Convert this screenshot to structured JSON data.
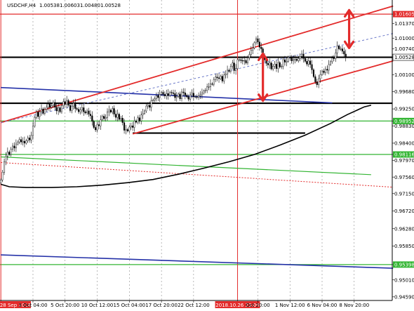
{
  "chart_data": {
    "type": "candlestick",
    "title": "USDCHF,H4",
    "header_values": [
      "1.00538",
      "1.00603",
      "1.00480",
      "1.00528"
    ],
    "ylim": [
      0.945,
      1.0195
    ],
    "y_ticks": [
      {
        "value": 1.016,
        "label": "1.01605",
        "highlight": "#e32b2b"
      },
      {
        "value": 1.0137,
        "label": "1.01370"
      },
      {
        "value": 1.01,
        "label": "1.01000"
      },
      {
        "value": 1.0074,
        "label": "1.00740"
      },
      {
        "value": 1.0053,
        "label": "1.00528",
        "highlight": "#ffffff"
      },
      {
        "value": 1.001,
        "label": "1.00100"
      },
      {
        "value": 0.9968,
        "label": "0.99680"
      },
      {
        "value": 0.9925,
        "label": "0.99250"
      },
      {
        "value": 0.9895,
        "label": "0.98952",
        "highlight": "#33b533"
      },
      {
        "value": 0.9883,
        "label": "0.98830"
      },
      {
        "value": 0.984,
        "label": "0.98400"
      },
      {
        "value": 0.9812,
        "label": "0.98116",
        "highlight": "#33b533"
      },
      {
        "value": 0.9797,
        "label": "0.97970"
      },
      {
        "value": 0.9756,
        "label": "0.97560"
      },
      {
        "value": 0.9715,
        "label": "0.97150"
      },
      {
        "value": 0.9672,
        "label": "0.96720"
      },
      {
        "value": 0.9628,
        "label": "0.96280"
      },
      {
        "value": 0.9585,
        "label": "0.95850"
      },
      {
        "value": 0.9539,
        "label": "0.95398",
        "highlight": "#33b533"
      },
      {
        "value": 0.9501,
        "label": "0.95010"
      },
      {
        "value": 0.9459,
        "label": "0.94590"
      }
    ],
    "x_labels": [
      {
        "idx": 0,
        "label": "28 Sep 2018",
        "highlight": "#e32b2b"
      },
      {
        "idx": 19,
        "label": "3 Oct 04:00"
      },
      {
        "idx": 38,
        "label": "5 Oct 20:00"
      },
      {
        "idx": 57,
        "label": "10 Oct 12:00"
      },
      {
        "idx": 76,
        "label": "15 Oct 04:00"
      },
      {
        "idx": 95,
        "label": "17 Oct 20:00"
      },
      {
        "idx": 114,
        "label": "22 Oct 12:00"
      },
      {
        "idx": 140,
        "label": "2018.10.26 23:00",
        "highlight": "#e32b2b"
      },
      {
        "idx": 152,
        "label": "Oct 20:00"
      },
      {
        "idx": 171,
        "label": "1 Nov 12:00"
      },
      {
        "idx": 190,
        "label": "6 Nov 04:00"
      },
      {
        "idx": 209,
        "label": "8 Nov 20:00"
      }
    ],
    "series_close": [
      0.9749,
      0.9768,
      0.9794,
      0.9808,
      0.9818,
      0.9812,
      0.9825,
      0.9833,
      0.9828,
      0.9838,
      0.9843,
      0.9849,
      0.9843,
      0.9845,
      0.984,
      0.9846,
      0.9853,
      0.9848,
      0.9859,
      0.9882,
      0.9904,
      0.9917,
      0.9906,
      0.9918,
      0.9925,
      0.9914,
      0.9924,
      0.9929,
      0.9937,
      0.9929,
      0.9933,
      0.9941,
      0.9929,
      0.992,
      0.9928,
      0.9918,
      0.9933,
      0.9943,
      0.9936,
      0.9946,
      0.9934,
      0.9921,
      0.9932,
      0.9939,
      0.9926,
      0.9924,
      0.9918,
      0.9922,
      0.9928,
      0.9918,
      0.9915,
      0.992,
      0.9912,
      0.9908,
      0.9894,
      0.9879,
      0.9873,
      0.9886,
      0.9883,
      0.9898,
      0.9907,
      0.9901,
      0.9904,
      0.9917,
      0.9922,
      0.9917,
      0.9926,
      0.9912,
      0.9904,
      0.9912,
      0.9899,
      0.9902,
      0.9891,
      0.9872,
      0.9874,
      0.987,
      0.988,
      0.9883,
      0.9879,
      0.9895,
      0.9892,
      0.9903,
      0.9895,
      0.991,
      0.9914,
      0.992,
      0.9932,
      0.9934,
      0.9929,
      0.9945,
      0.9947,
      0.995,
      0.9958,
      0.9953,
      0.9961,
      0.9966,
      0.9961,
      0.9957,
      0.9963,
      0.9958,
      0.9966,
      0.9965,
      0.9963,
      0.9953,
      0.9956,
      0.9962,
      0.995,
      0.9967,
      0.9965,
      0.9959,
      0.9955,
      0.9949,
      0.996,
      0.9964,
      0.9955,
      0.9955,
      0.9954,
      0.9958,
      0.996,
      0.9964,
      0.9969,
      0.9971,
      0.998,
      0.998,
      0.9987,
      0.9986,
      0.9998,
      1.0004,
      1.0002,
      1.0,
      1.0006,
      0.9994,
      1.0009,
      1.0011,
      1.0021,
      1.0018,
      1.0031,
      1.0039,
      1.002,
      1.0025,
      1.0047,
      1.0047,
      1.0045,
      1.0044,
      1.0045,
      1.0039,
      1.0052,
      1.006,
      1.0071,
      1.0076,
      1.0089,
      1.0099,
      1.0091,
      1.0078,
      1.0074,
      1.0057,
      1.0047,
      1.0038,
      1.0034,
      1.0039,
      1.0024,
      1.0031,
      1.0036,
      1.0025,
      1.004,
      1.0029,
      1.003,
      1.0047,
      1.0041,
      1.0043,
      1.0053,
      1.0051,
      1.0044,
      1.0048,
      1.0048,
      1.0045,
      1.005,
      1.0055,
      1.0061,
      1.005,
      1.0043,
      1.0036,
      1.0044,
      1.0035,
      1.0022,
      1.0005,
      0.9992,
      0.9985,
      1.0,
      1.001,
      1.0019,
      1.0015,
      1.0023,
      1.0021,
      1.0035,
      1.0042,
      1.0051,
      1.005,
      1.0064,
      1.0081,
      1.0074,
      1.0074,
      1.0068,
      1.0061,
      1.0053
    ],
    "ma_long": [
      [
        0,
        0.9738
      ],
      [
        5,
        0.9732
      ],
      [
        15,
        0.973
      ],
      [
        30,
        0.973
      ],
      [
        45,
        0.9732
      ],
      [
        60,
        0.9736
      ],
      [
        75,
        0.9742
      ],
      [
        90,
        0.975
      ],
      [
        105,
        0.9763
      ],
      [
        120,
        0.9778
      ],
      [
        135,
        0.9794
      ],
      [
        150,
        0.9812
      ],
      [
        165,
        0.9835
      ],
      [
        180,
        0.986
      ],
      [
        195,
        0.9889
      ],
      [
        205,
        0.9911
      ],
      [
        215,
        0.993
      ],
      [
        219,
        0.9934
      ]
    ],
    "ma_long_2": [
      [
        0,
        0.9806
      ],
      [
        219,
        0.9762
      ]
    ],
    "ma_dashed": [
      [
        0,
        0.9792
      ],
      [
        232,
        0.9731
      ]
    ],
    "horizontal_levels": [
      {
        "value": 1.016,
        "color": "#e32b2b",
        "width": 1.2
      },
      {
        "value": 1.0053,
        "color": "#000000",
        "width": 2.2
      },
      {
        "value": 0.9939,
        "color": "#000000",
        "width": 2.2
      },
      {
        "value": 0.9865,
        "color": "#000000",
        "width": 2.2,
        "x0": 78,
        "x1": 180
      },
      {
        "value": 0.9895,
        "color": "#33b533",
        "width": 1.2
      },
      {
        "value": 0.9812,
        "color": "#33b533",
        "width": 1.2
      },
      {
        "value": 0.9539,
        "color": "#33b533",
        "width": 1.2
      }
    ],
    "blue_lines": [
      {
        "points": [
          [
            0,
            0.9978
          ],
          [
            196,
            0.994
          ]
        ],
        "color": "#2431a8",
        "width": 1.6
      },
      {
        "points": [
          [
            0,
            0.9563
          ],
          [
            232,
            0.953
          ]
        ],
        "color": "#2431a8",
        "width": 1.6
      }
    ],
    "channel_lines": [
      {
        "points": [
          [
            0,
            0.9891
          ],
          [
            232,
            1.018
          ]
        ],
        "color": "#e32b2b",
        "width": 1.8
      },
      {
        "points": [
          [
            78,
            0.9863
          ],
          [
            232,
            1.0044
          ]
        ],
        "color": "#e32b2b",
        "width": 1.8
      },
      {
        "points": [
          [
            0,
            0.9891
          ],
          [
            232,
            1.0112
          ]
        ],
        "color": "#6b79c9",
        "width": 1,
        "dash": "3,3"
      }
    ],
    "arrows": [
      {
        "x": 155,
        "y_top": 1.0062,
        "y_bottom": 0.9945
      },
      {
        "x": 206,
        "y_top": 1.017,
        "y_bottom": 1.0076
      }
    ],
    "vertical_markers": [
      {
        "idx": 0,
        "color": "#e32b2b"
      },
      {
        "idx": 140,
        "color": "#e32b2b"
      }
    ]
  }
}
